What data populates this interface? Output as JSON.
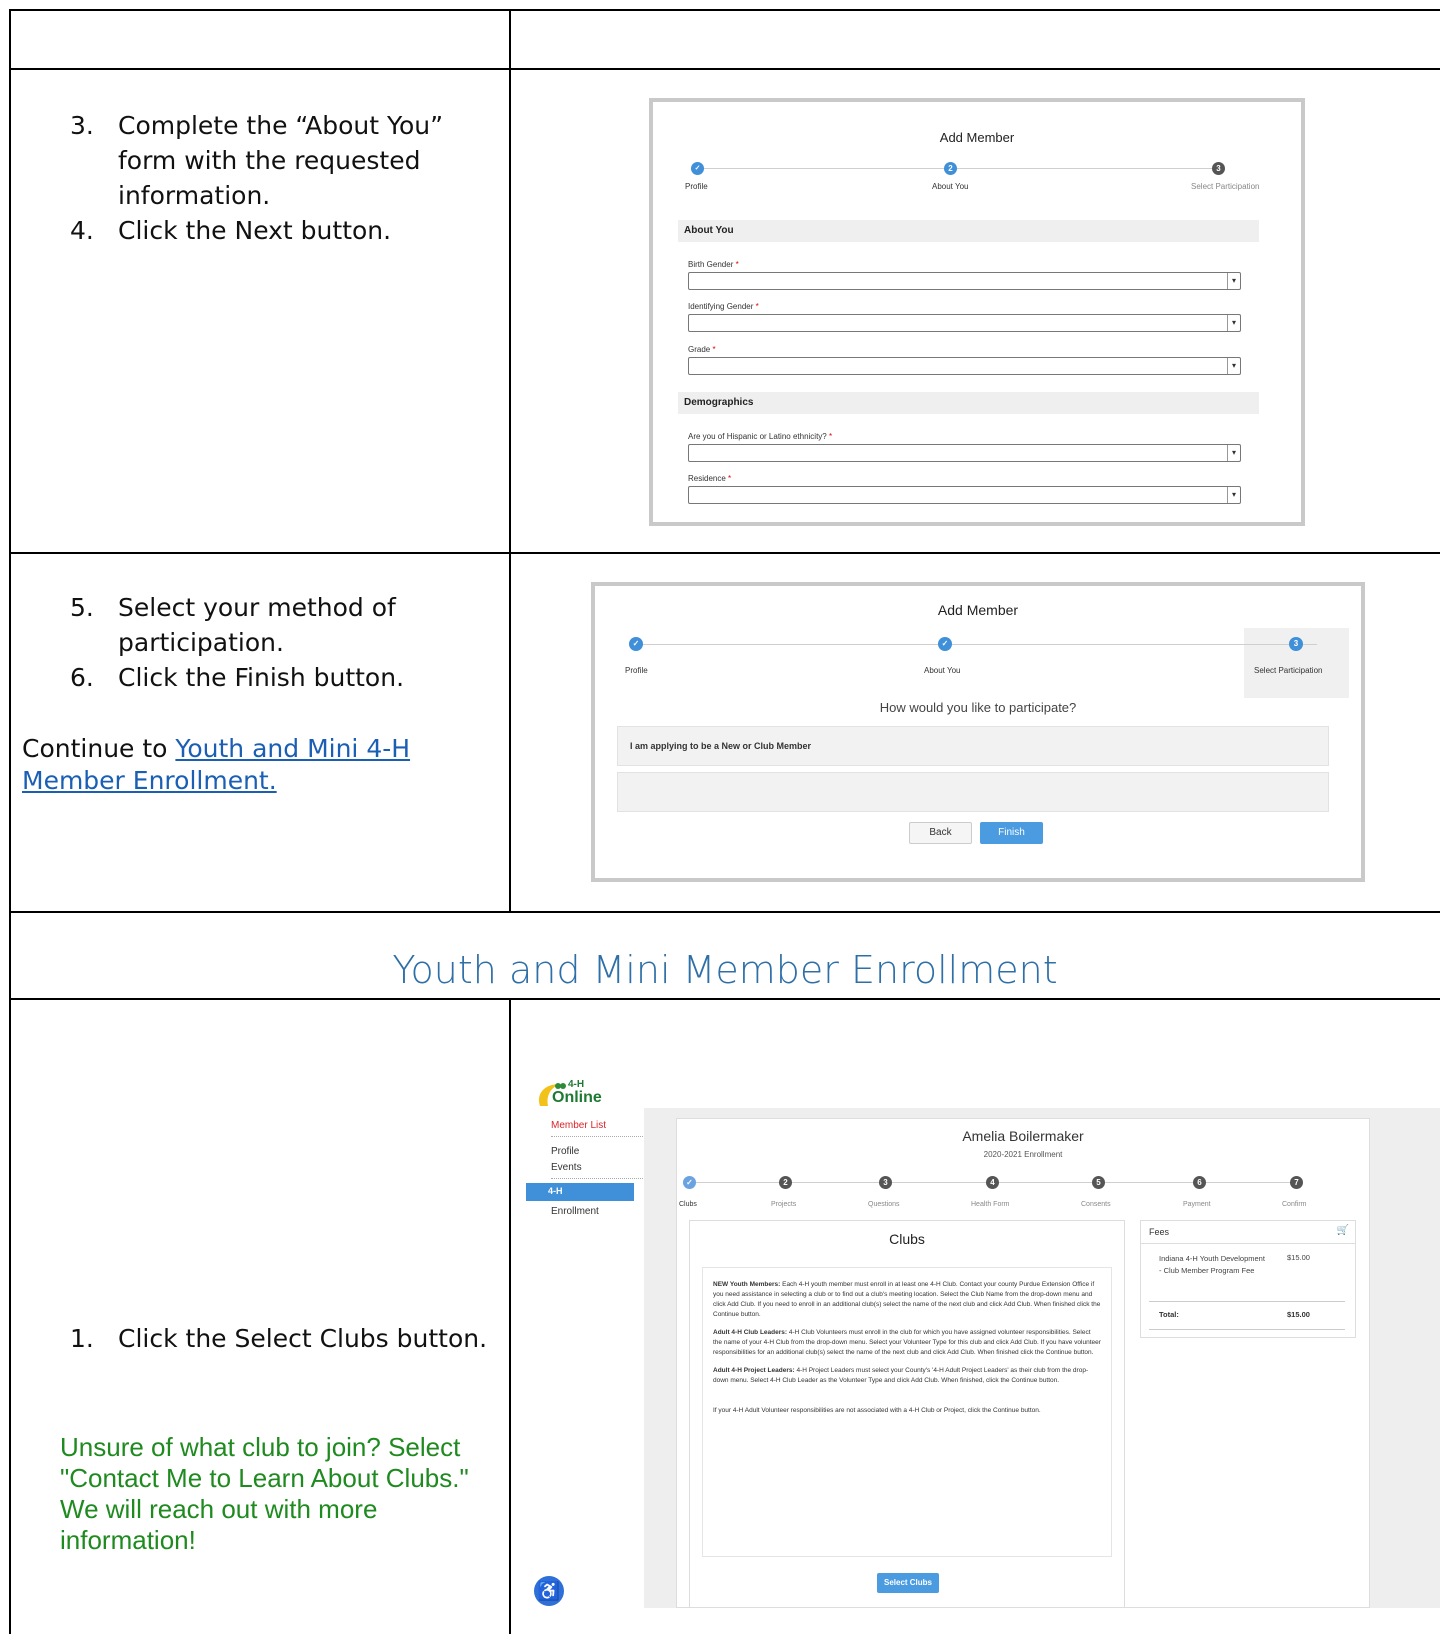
{
  "section1": {
    "steps": [
      {
        "num": "3.",
        "text": "Complete the “About You” form with the requested information."
      },
      {
        "num": "4.",
        "text": "Click the Next button."
      }
    ]
  },
  "section2": {
    "steps": [
      {
        "num": "5.",
        "text": "Select your method of participation."
      },
      {
        "num": "6.",
        "text": "Click the Finish button."
      }
    ],
    "continue_prefix": "Continue to ",
    "continue_link": "Youth and Mini 4-H Member Enrollment."
  },
  "heading": "Youth and Mini Member Enrollment",
  "section3": {
    "steps": [
      {
        "num": "1.",
        "text": "Click the Select Clubs button."
      }
    ],
    "note": "Unsure of what club to join? Select \"Contact Me to Learn About Clubs.\" We will reach out with more information!"
  },
  "shot1": {
    "title": "Add Member",
    "steps": [
      {
        "num": "",
        "label": "Profile",
        "state": "done"
      },
      {
        "num": "2",
        "label": "About You",
        "state": "active"
      },
      {
        "num": "3",
        "label": "Select Participation",
        "state": "todo"
      }
    ],
    "about_header": "About You",
    "fields_about": [
      "Birth Gender",
      "Identifying Gender",
      "Grade"
    ],
    "demographics_header": "Demographics",
    "fields_demo": [
      "Are you of Hispanic or Latino ethnicity?",
      "Residence"
    ],
    "required_mark": "*"
  },
  "shot2": {
    "title": "Add Member",
    "steps": [
      {
        "label": "Profile"
      },
      {
        "label": "About You"
      },
      {
        "num": "3",
        "label": "Select Participation"
      }
    ],
    "question": "How would you like to participate?",
    "option1": "I am applying to be a New or Club Member",
    "back_label": "Back",
    "finish_label": "Finish"
  },
  "shot3": {
    "logo_text": "4-H",
    "logo_sub": "Online",
    "sidebar": {
      "member_list": "Member List",
      "profile": "Profile",
      "events": "Events",
      "active": "4-H",
      "enrollment": "Enrollment"
    },
    "member_name": "Amelia Boilermaker",
    "enrollment_year": "2020-2021 Enrollment",
    "steps": [
      {
        "num": "",
        "label": "Clubs"
      },
      {
        "num": "2",
        "label": "Projects"
      },
      {
        "num": "3",
        "label": "Questions"
      },
      {
        "num": "4",
        "label": "Health Form"
      },
      {
        "num": "5",
        "label": "Consents"
      },
      {
        "num": "6",
        "label": "Payment"
      },
      {
        "num": "7",
        "label": "Confirm"
      }
    ],
    "clubs_title": "Clubs",
    "para1_bold": "NEW Youth Members:",
    "para1": " Each 4-H youth member must enroll in at least one 4-H Club. Contact your county Purdue Extension Office if you need assistance in selecting a club or to find out a club's meeting location. Select the Club Name from the drop-down menu and click Add Club. If you need to enroll in an additional club(s) select the name of the next club and click Add Club. When finished click the Continue button.",
    "para2_bold": "Adult 4-H Club Leaders:",
    "para2": " 4-H Club Volunteers must enroll in the club for which you have assigned volunteer responsibilities. Select the name of your 4-H Club from the drop-down menu. Select your Volunteer Type for this club and click Add Club. If you have volunteer responsibilities for an additional club(s) select the name of the next club and click Add Club. When finished click the Continue button.",
    "para3_bold": "Adult 4-H Project Leaders:",
    "para3": " 4-H Project Leaders must select your County's '4-H Adult Project Leaders' as their club from the drop-down menu. Select 4-H Club Leader as the Volunteer Type and click Add Club. When finished, click the Continue button.",
    "para4": "If your 4-H Adult Volunteer responsibilities are not associated with a 4-H Club or Project, click the Continue button.",
    "select_clubs_label": "Select Clubs",
    "fees_title": "Fees",
    "fee_item": "Indiana 4-H Youth Development - Club Member Program Fee",
    "fee_amount": "$15.00",
    "total_label": "Total:",
    "total_amount": "$15.00"
  },
  "colors": {
    "accent_blue": "#3f8fd9",
    "heading_blue": "#2e6fa7",
    "link_blue": "#1a5fb4",
    "note_green": "#1f8a1f",
    "sidebar_red": "#d9262a"
  }
}
